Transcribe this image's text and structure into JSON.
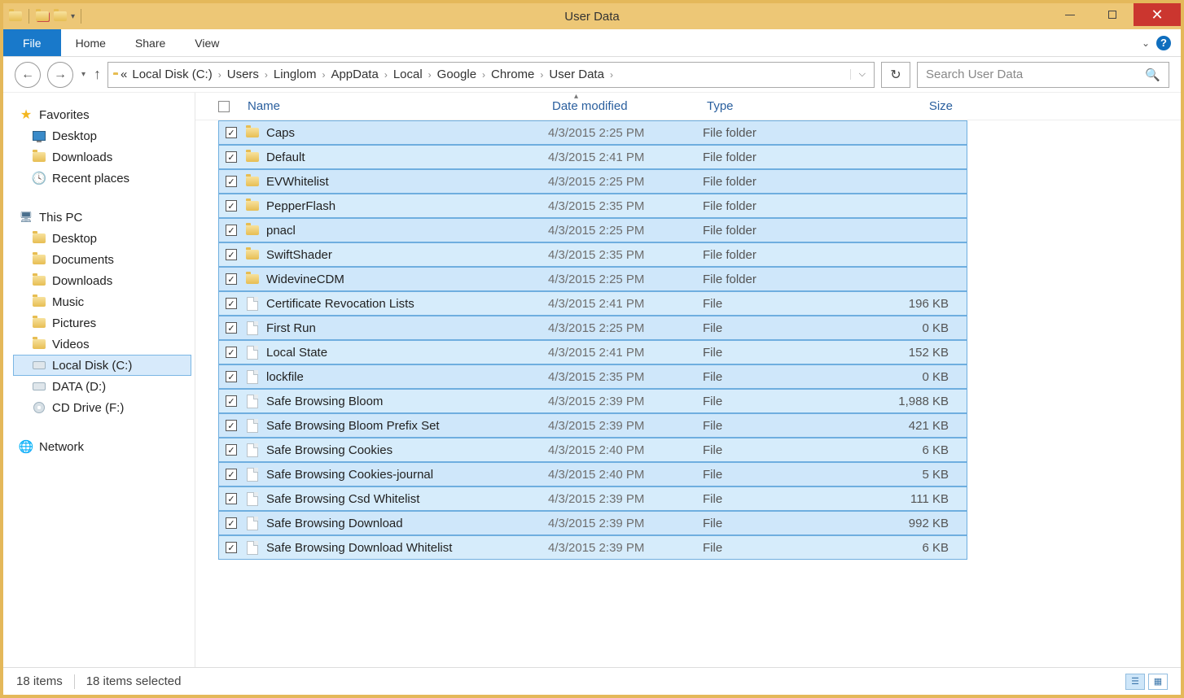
{
  "window": {
    "title": "User Data"
  },
  "ribbon": {
    "file": "File",
    "home": "Home",
    "share": "Share",
    "view": "View"
  },
  "breadcrumbs": [
    "Local Disk (C:)",
    "Users",
    "Linglom",
    "AppData",
    "Local",
    "Google",
    "Chrome",
    "User Data"
  ],
  "search": {
    "placeholder": "Search User Data"
  },
  "nav": {
    "favorites": {
      "label": "Favorites",
      "items": [
        "Desktop",
        "Downloads",
        "Recent places"
      ]
    },
    "thispc": {
      "label": "This PC",
      "items": [
        "Desktop",
        "Documents",
        "Downloads",
        "Music",
        "Pictures",
        "Videos",
        "Local Disk (C:)",
        "DATA (D:)",
        "CD Drive (F:)"
      ]
    },
    "network": {
      "label": "Network"
    }
  },
  "columns": {
    "name": "Name",
    "date": "Date modified",
    "type": "Type",
    "size": "Size"
  },
  "files": [
    {
      "name": "Caps",
      "date": "4/3/2015 2:25 PM",
      "type": "File folder",
      "size": "",
      "icon": "folder"
    },
    {
      "name": "Default",
      "date": "4/3/2015 2:41 PM",
      "type": "File folder",
      "size": "",
      "icon": "folder"
    },
    {
      "name": "EVWhitelist",
      "date": "4/3/2015 2:25 PM",
      "type": "File folder",
      "size": "",
      "icon": "folder"
    },
    {
      "name": "PepperFlash",
      "date": "4/3/2015 2:35 PM",
      "type": "File folder",
      "size": "",
      "icon": "folder"
    },
    {
      "name": "pnacl",
      "date": "4/3/2015 2:25 PM",
      "type": "File folder",
      "size": "",
      "icon": "folder"
    },
    {
      "name": "SwiftShader",
      "date": "4/3/2015 2:35 PM",
      "type": "File folder",
      "size": "",
      "icon": "folder"
    },
    {
      "name": "WidevineCDM",
      "date": "4/3/2015 2:25 PM",
      "type": "File folder",
      "size": "",
      "icon": "folder"
    },
    {
      "name": "Certificate Revocation Lists",
      "date": "4/3/2015 2:41 PM",
      "type": "File",
      "size": "196 KB",
      "icon": "file"
    },
    {
      "name": "First Run",
      "date": "4/3/2015 2:25 PM",
      "type": "File",
      "size": "0 KB",
      "icon": "file"
    },
    {
      "name": "Local State",
      "date": "4/3/2015 2:41 PM",
      "type": "File",
      "size": "152 KB",
      "icon": "file"
    },
    {
      "name": "lockfile",
      "date": "4/3/2015 2:35 PM",
      "type": "File",
      "size": "0 KB",
      "icon": "file"
    },
    {
      "name": "Safe Browsing Bloom",
      "date": "4/3/2015 2:39 PM",
      "type": "File",
      "size": "1,988 KB",
      "icon": "file"
    },
    {
      "name": "Safe Browsing Bloom Prefix Set",
      "date": "4/3/2015 2:39 PM",
      "type": "File",
      "size": "421 KB",
      "icon": "file"
    },
    {
      "name": "Safe Browsing Cookies",
      "date": "4/3/2015 2:40 PM",
      "type": "File",
      "size": "6 KB",
      "icon": "file"
    },
    {
      "name": "Safe Browsing Cookies-journal",
      "date": "4/3/2015 2:40 PM",
      "type": "File",
      "size": "5 KB",
      "icon": "file"
    },
    {
      "name": "Safe Browsing Csd Whitelist",
      "date": "4/3/2015 2:39 PM",
      "type": "File",
      "size": "111 KB",
      "icon": "file"
    },
    {
      "name": "Safe Browsing Download",
      "date": "4/3/2015 2:39 PM",
      "type": "File",
      "size": "992 KB",
      "icon": "file"
    },
    {
      "name": "Safe Browsing Download Whitelist",
      "date": "4/3/2015 2:39 PM",
      "type": "File",
      "size": "6 KB",
      "icon": "file"
    }
  ],
  "status": {
    "count": "18 items",
    "selected": "18 items selected"
  }
}
